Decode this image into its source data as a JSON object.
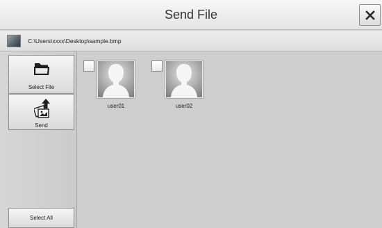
{
  "header": {
    "title": "Send File",
    "close_icon": "close-icon"
  },
  "path_bar": {
    "file_icon": "image-file-icon",
    "path": "C:\\Users\\xxxx\\Desktop\\sample.bmp"
  },
  "sidebar": {
    "select_file": {
      "label": "Select File",
      "icon": "folder-icon"
    },
    "send": {
      "label": "Send",
      "icon": "send-files-icon"
    },
    "select_all": {
      "label": "Select All"
    }
  },
  "users": [
    {
      "name": "user01",
      "checked": false,
      "icon": "user-avatar-icon"
    },
    {
      "name": "user02",
      "checked": false,
      "icon": "user-avatar-icon"
    }
  ]
}
